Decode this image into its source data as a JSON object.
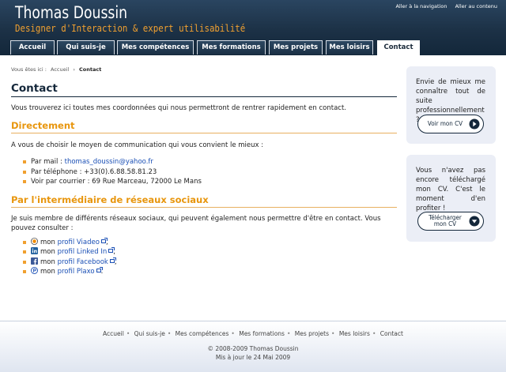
{
  "header": {
    "site_title": "Thomas Doussin",
    "tagline": "Designer d'Interaction & expert utilisabilité",
    "skip_navigation": "Aller à la navigation",
    "skip_content": "Aller au contenu"
  },
  "nav": {
    "tabs": [
      {
        "label": "Accueil"
      },
      {
        "label": "Qui suis-je"
      },
      {
        "label": "Mes compétences"
      },
      {
        "label": "Mes formations"
      },
      {
        "label": "Mes projets"
      },
      {
        "label": "Mes loisirs"
      },
      {
        "label": "Contact",
        "active": true
      }
    ]
  },
  "breadcrumb": {
    "prefix": "Vous êtes ici :",
    "home": "Accueil",
    "separator": "›",
    "current": "Contact"
  },
  "main": {
    "title": "Contact",
    "intro": "Vous trouverez ici toutes mes coordonnées qui nous permettront de rentrer rapidement en contact.",
    "direct": {
      "title": "Directement",
      "text": "A vous de choisir le moyen de communication qui vous convient le mieux :",
      "mail_label": "Par mail :",
      "mail_value": "thomas_doussin@yahoo.fr",
      "phone_label": "Par téléphone :",
      "phone_value": "+33(0).6.88.58.81.23",
      "post_label": "Voir par courrier :",
      "post_value": "69 Rue Marceau, 72000 Le Mans"
    },
    "social": {
      "title": "Par l'intermédiaire de réseaux sociaux",
      "text": "Je suis membre de différents réseaux sociaux, qui peuvent également nous permettre d'être en contact. Vous pouvez consulter :",
      "items": [
        {
          "prefix": "mon",
          "link": "profil Viadeo",
          "end": ","
        },
        {
          "prefix": "mon",
          "link": "profil Linked In",
          "end": ","
        },
        {
          "prefix": "mon",
          "link": "profil Facebook",
          "end": ","
        },
        {
          "prefix": "mon",
          "link": "profil Plaxo",
          "end": "."
        }
      ]
    }
  },
  "sidebar": {
    "box1": {
      "text": "Envie de mieux me connaître tout de suite professionnellement ?",
      "button": "Voir mon CV"
    },
    "box2": {
      "text": "Vous n'avez pas encore téléchargé mon CV. C'est le moment d'en profiter !",
      "button_line1": "Télécharger",
      "button_line2": "mon CV"
    }
  },
  "footer": {
    "links": [
      "Accueil",
      "Qui suis-je",
      "Mes compétences",
      "Mes formations",
      "Mes projets",
      "Mes loisirs",
      "Contact"
    ],
    "separator": "•",
    "copyright": "© 2008-2009 Thomas Doussin",
    "updated": "Mis à jour le 24 Mai 2009"
  },
  "colors": {
    "header_dark": "#1c3146",
    "accent_orange": "#e8960e",
    "link_blue": "#1a4fb5",
    "sidebar_bg": "#ebeef6"
  }
}
